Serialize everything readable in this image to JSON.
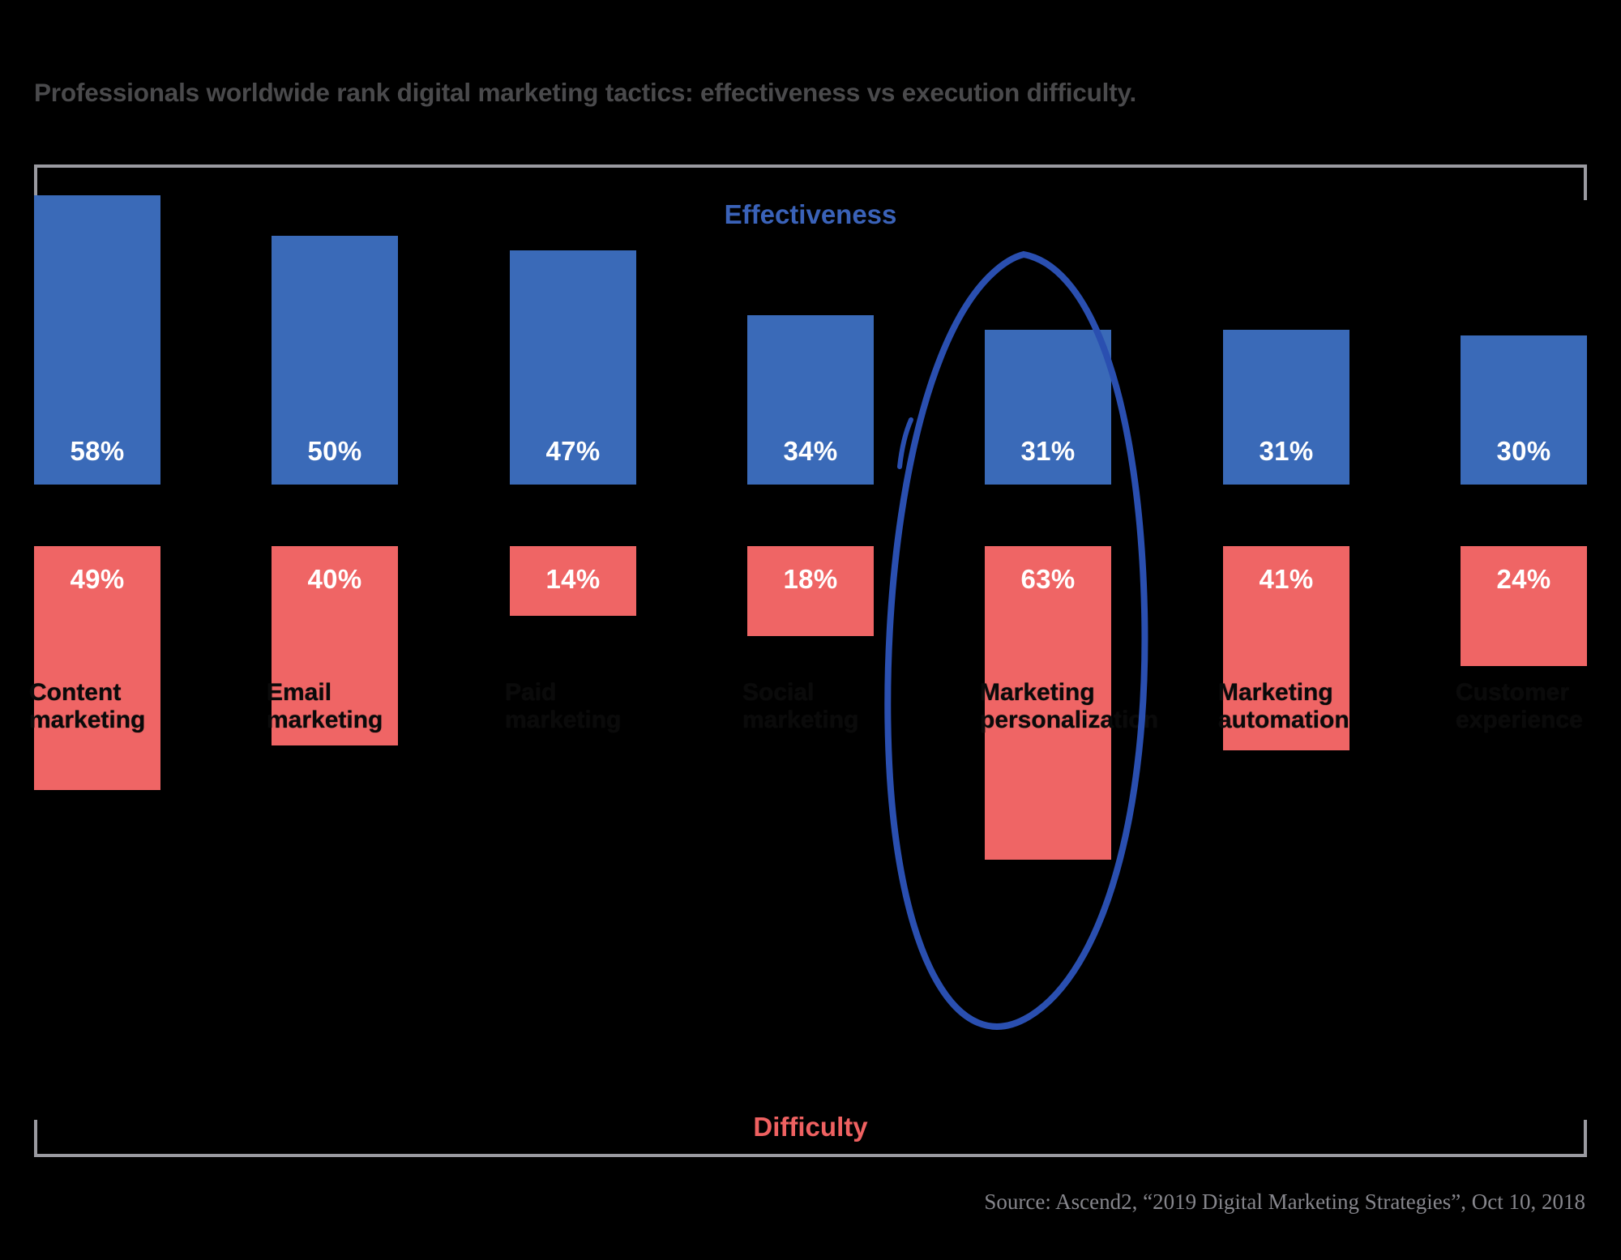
{
  "title": "Professionals worldwide rank digital marketing tactics: effectiveness vs execution difficulty.",
  "axis": {
    "top_label": "Effectiveness",
    "bottom_label": "Difficulty"
  },
  "source": "Source: Ascend2, “2019 Digital Marketing Strategies”, Oct 10, 2018",
  "colors": {
    "effectiveness": "#3a6ab8",
    "difficulty": "#ef6565",
    "effectiveness_label": "#3a62b8",
    "difficulty_label": "#ef6161",
    "title": "#4a4a4c",
    "frame": "#9a9aa0",
    "annotation": "#2a4fb0",
    "background": "#000000",
    "category_label": "#0a0a0a"
  },
  "annotation": {
    "shape": "hand-drawn-ellipse",
    "highlights_category_index": 4
  },
  "chart_data": {
    "type": "bar",
    "title": "Professionals worldwide rank digital marketing tactics: effectiveness vs execution difficulty.",
    "xlabel": "",
    "ylabel": "",
    "ylim": [
      0,
      70
    ],
    "grid": false,
    "legend_position": "axis-captions",
    "orientation": "diverging-vertical",
    "categories": [
      "Content\nmarketing",
      "Email\nmarketing",
      "Paid\nmarketing",
      "Social\nmarketing",
      "Marketing\npersonalization",
      "Marketing\nautomation",
      "Customer\nexperience"
    ],
    "series": [
      {
        "name": "Effectiveness",
        "color": "#3a6ab8",
        "direction": "up",
        "values": [
          58,
          50,
          47,
          34,
          31,
          31,
          30
        ],
        "labels": [
          "58%",
          "50%",
          "47%",
          "34%",
          "31%",
          "31%",
          "30%"
        ]
      },
      {
        "name": "Difficulty",
        "color": "#ef6565",
        "direction": "down",
        "values": [
          49,
          40,
          14,
          18,
          63,
          41,
          24
        ],
        "labels": [
          "49%",
          "40%",
          "14%",
          "18%",
          "63%",
          "41%",
          "24%"
        ]
      }
    ]
  }
}
